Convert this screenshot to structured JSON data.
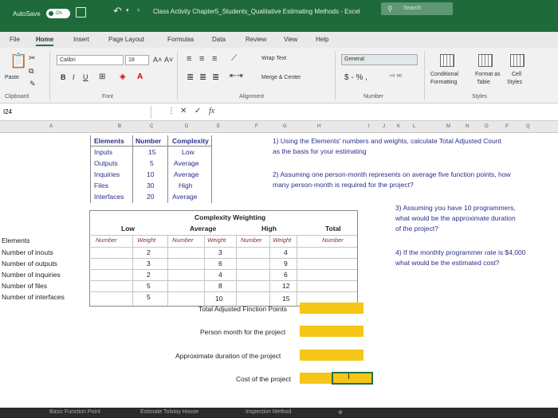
{
  "title_bar": {
    "autosave": "AutoSave",
    "toggle": "On",
    "doc_title": "Class Activity Chapter5_Students_Qualitative Estimating Methods  -  Excel",
    "search": "Search"
  },
  "tabs": [
    "File",
    "Home",
    "Insert",
    "Page Layout",
    "Formulas",
    "Data",
    "Review",
    "View",
    "Help"
  ],
  "ribbon": {
    "paste": "Paste",
    "font_name": "Calibri",
    "font_size": "18",
    "bold": "B",
    "italic": "I",
    "underline": "U",
    "wrap_text": "Wrap Text",
    "merge_center": "Merge & Center",
    "number_format": "General",
    "currency": "$ - % ,",
    "cond_format_1": "Conditional",
    "cond_format_2": "Formatting",
    "format_as_1": "Format as",
    "format_as_2": "Table",
    "cell_styles_1": "Cell",
    "cell_styles_2": "Styles",
    "groups": {
      "clipboard": "Clipboard",
      "font": "Font",
      "alignment": "Alignment",
      "number": "Number",
      "styles": "Styles"
    }
  },
  "formula_bar": {
    "name_box": "I24",
    "fx": "fx"
  },
  "columns": [
    "A",
    "B",
    "C",
    "D",
    "E",
    "F",
    "G",
    "H",
    "I",
    "J",
    "K",
    "L",
    "M",
    "N",
    "O",
    "P",
    "Q"
  ],
  "sheet": {
    "elements_table": {
      "headers": [
        "Elements",
        "Number",
        "Complexity"
      ],
      "rows": [
        [
          "Inputs",
          "15",
          "Low"
        ],
        [
          "Outputs",
          "5",
          "Average"
        ],
        [
          "Inquiries",
          "10",
          "Average"
        ],
        [
          "Files",
          "30",
          "High"
        ],
        [
          "Interfaces",
          "20",
          "Average"
        ]
      ]
    },
    "questions": {
      "q1": "1) Using the Elements' numbers and weights, calculate Total Adjusted Count",
      "q1b": "as the basis for your estimating",
      "q2": "2) Assuming one person-month represents on average five function points, how",
      "q2b": "many person-month is required for the project?",
      "q3a": "3) Assuming you have 10 programmers,",
      "q3b": "what would be the approximate duration",
      "q3c": "of the project?",
      "q4a": "4) If the monthly programmer rate is $4,000",
      "q4b": "what would be the estimated cost?"
    },
    "weighting": {
      "title": "Complexity Weighting",
      "low": "Low",
      "average": "Average",
      "high": "High",
      "total": "Total",
      "number": "Number",
      "weight": "Weight",
      "elements_label": "Elements",
      "rows": [
        {
          "label": "Number of inouts",
          "low_w": "2",
          "avg_w": "3",
          "high_w": "4"
        },
        {
          "label": "Number of outputs",
          "low_w": "3",
          "avg_w": "6",
          "high_w": "9"
        },
        {
          "label": "Number of inquiries",
          "low_w": "2",
          "avg_w": "4",
          "high_w": "6"
        },
        {
          "label": "Number of files",
          "low_w": "5",
          "avg_w": "8",
          "high_w": "12"
        },
        {
          "label": "Number of interfaces",
          "low_w": "5",
          "avg_w": "10",
          "high_w": "15"
        }
      ]
    },
    "answers": {
      "total": "Total Adjusted Finction Points",
      "person_month": "Person month for the project",
      "duration": "Approximate duration of the project",
      "cost": "Cost of the project"
    },
    "sheet_tabs": [
      "Basic Function Point",
      "Estimate Tolstoy House",
      "Inspection Method"
    ]
  },
  "colors": {
    "excel_green": "#1f6a3a",
    "highlight": "#f5c518",
    "header_blue": "#2a2e8a"
  }
}
